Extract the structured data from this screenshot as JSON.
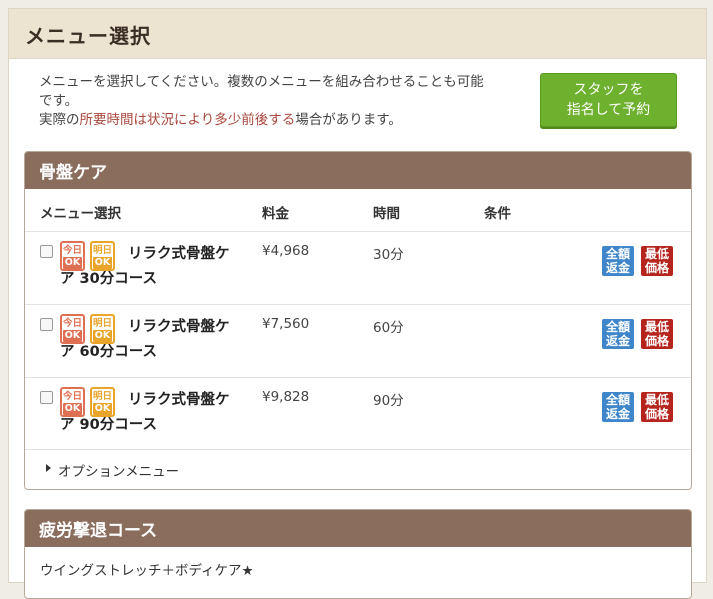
{
  "header": {
    "title": "メニュー選択"
  },
  "intro": {
    "line1": "メニューを選択してください。複数のメニューを組み合わせることも可能",
    "line2": "です。",
    "line3_prefix": "実際の",
    "line3_highlight": "所要時間は状況により多少前後する",
    "line3_suffix": "場合があります。"
  },
  "staff_button": {
    "line1": "スタッフを",
    "line2": "指名して予約"
  },
  "section1": {
    "title": "骨盤ケア",
    "columns": {
      "menu": "メニュー選択",
      "price": "料金",
      "time": "時間",
      "conditions": "条件"
    },
    "tags": {
      "today_top": "今日",
      "today_bottom": "OK",
      "tomorrow_top": "明日",
      "tomorrow_bottom": "OK"
    },
    "badges": {
      "refund_top": "全額",
      "refund_bottom": "返金",
      "lowest_top": "最低",
      "lowest_bottom": "価格"
    },
    "items": [
      {
        "name": "リラク式骨盤ケア 30分コース",
        "price": "¥4,968",
        "time": "30分"
      },
      {
        "name": "リラク式骨盤ケア 60分コース",
        "price": "¥7,560",
        "time": "60分"
      },
      {
        "name": "リラク式骨盤ケア 90分コース",
        "price": "¥9,828",
        "time": "90分"
      }
    ],
    "option_label": "オプションメニュー"
  },
  "section2": {
    "title": "疲労撃退コース",
    "first_item": "ウイングストレッチ＋ボディケア★"
  }
}
